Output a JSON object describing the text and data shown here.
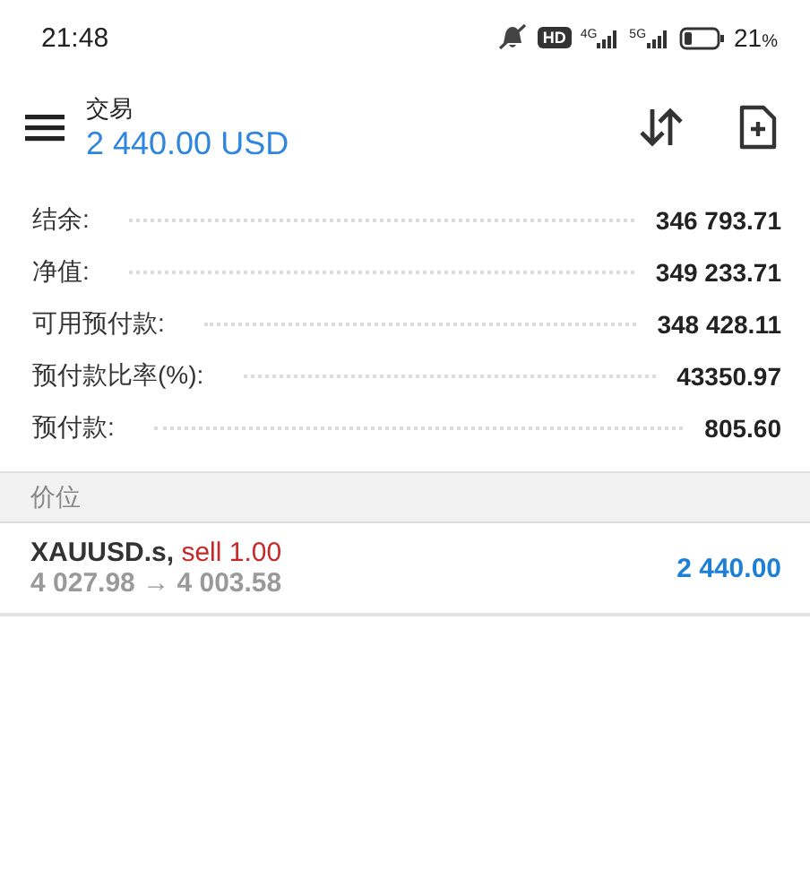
{
  "status_bar": {
    "time": "21:48",
    "hd_label": "HD",
    "networks": [
      "4G",
      "5G"
    ],
    "battery_text": "21",
    "battery_unit": "%"
  },
  "header": {
    "title": "交易",
    "balance": "2 440.00 USD"
  },
  "summary": [
    {
      "label": "结余:",
      "value": "346 793.71"
    },
    {
      "label": "净值:",
      "value": "349 233.71"
    },
    {
      "label": "可用预付款:",
      "value": "348 428.11"
    },
    {
      "label": "预付款比率(%):",
      "value": "43350.97"
    },
    {
      "label": "预付款:",
      "value": "805.60"
    }
  ],
  "section": {
    "title": "价位"
  },
  "positions": [
    {
      "symbol": "XAUUSD.s,",
      "kind": "sell",
      "type": "sell 1.00",
      "prices": "4 027.98 → 4 003.58",
      "profit": "2 440.00"
    }
  ]
}
